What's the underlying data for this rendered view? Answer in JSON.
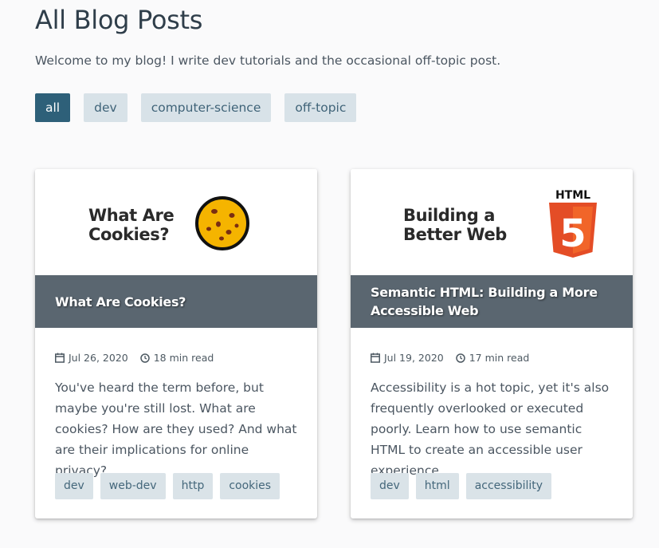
{
  "page": {
    "title": "All Blog Posts",
    "intro": "Welcome to my blog! I write dev tutorials and the occasional off-topic post."
  },
  "filters": [
    {
      "label": "all",
      "active": true
    },
    {
      "label": "dev",
      "active": false
    },
    {
      "label": "computer-science",
      "active": false
    },
    {
      "label": "off-topic",
      "active": false
    }
  ],
  "posts": [
    {
      "hero_line1": "What Are",
      "hero_line2": "Cookies?",
      "hero_icon": "cookie-icon",
      "title": "What Are Cookies?",
      "date": "Jul 26, 2020",
      "read_time": "18 min read",
      "excerpt": "You've heard the term before, but maybe you're still lost. What are cookies? How are they used? And what are their implications for online privacy?",
      "tags": [
        "dev",
        "web-dev",
        "http",
        "cookies"
      ]
    },
    {
      "hero_line1": "Building a",
      "hero_line2": "Better Web",
      "hero_icon": "html5-logo-icon",
      "hero_logo_text": "HTML",
      "hero_logo_digit": "5",
      "title": "Semantic HTML: Building a More Accessible Web",
      "date": "Jul 19, 2020",
      "read_time": "17 min read",
      "excerpt": "Accessibility is a hot topic, yet it's also frequently overlooked or executed poorly. Learn how to use semantic HTML to create an accessible user experience.",
      "tags": [
        "dev",
        "html",
        "accessibility"
      ]
    }
  ],
  "colors": {
    "accent": "#2e6079",
    "tag_bg": "#dae3e8",
    "title_band": "#5a6670",
    "page_bg": "#fafafb",
    "html5_orange": "#e44d26",
    "cookie_fill": "#f5b400"
  }
}
